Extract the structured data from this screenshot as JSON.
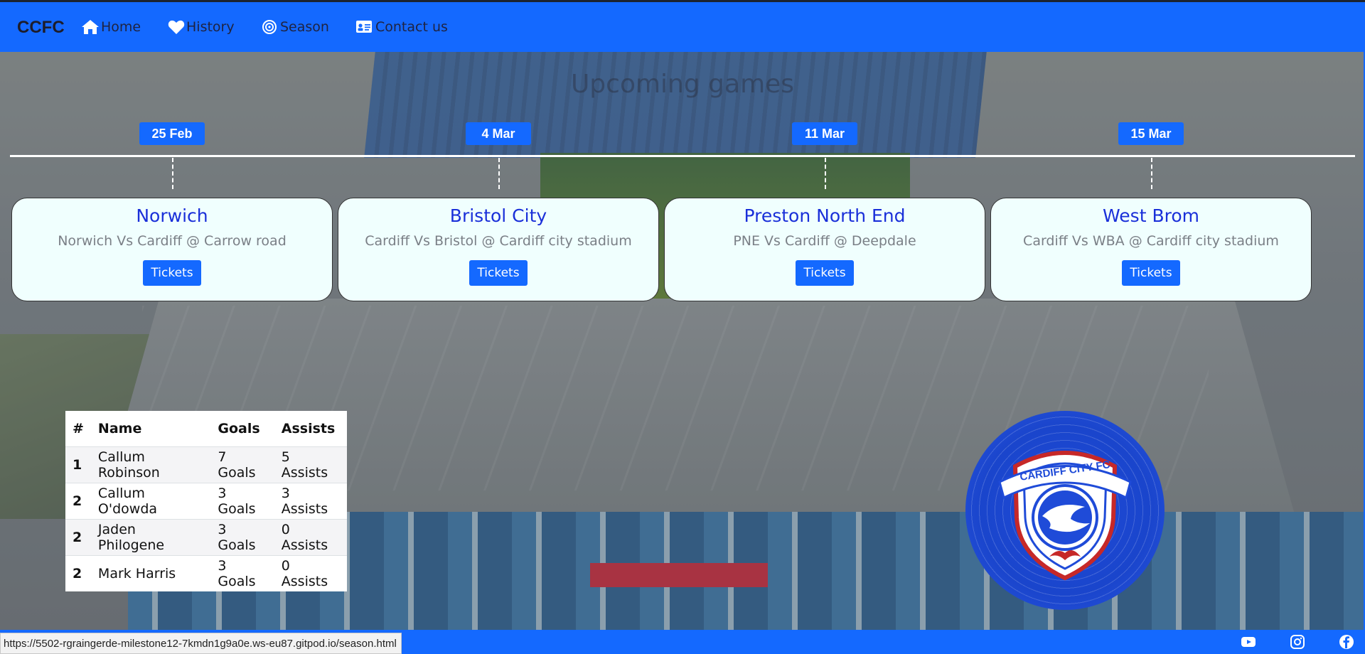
{
  "navbar": {
    "brand": "CCFC",
    "items": [
      {
        "label": "Home",
        "icon": "home-icon"
      },
      {
        "label": "History",
        "icon": "heart-icon"
      },
      {
        "label": "Season",
        "icon": "target-icon"
      },
      {
        "label": "Contact us",
        "icon": "contact-card-icon"
      }
    ]
  },
  "section_title": "Upcoming games",
  "fixtures": [
    {
      "date": "25 Feb",
      "title": "Norwich",
      "desc": "Norwich Vs Cardiff @ Carrow road",
      "button": "Tickets"
    },
    {
      "date": "4 Mar",
      "title": "Bristol City",
      "desc": "Cardiff Vs Bristol @ Cardiff city stadium",
      "button": "Tickets"
    },
    {
      "date": "11 Mar",
      "title": "Preston North End",
      "desc": "PNE Vs Cardiff @ Deepdale",
      "button": "Tickets"
    },
    {
      "date": "15 Mar",
      "title": "West Brom",
      "desc": "Cardiff Vs WBA @ Cardiff city stadium",
      "button": "Tickets"
    }
  ],
  "scorers": {
    "headers": [
      "#",
      "Name",
      "Goals",
      "Assists"
    ],
    "rows": [
      [
        "1",
        "Callum Robinson",
        "7 Goals",
        "5 Assists"
      ],
      [
        "2",
        "Callum O'dowda",
        "3 Goals",
        "3 Assists"
      ],
      [
        "2",
        "Jaden Philogene",
        "3 Goals",
        "0 Assists"
      ],
      [
        "2",
        "Mark Harris",
        "3 Goals",
        "0 Assists"
      ]
    ]
  },
  "crest": {
    "text": "CARDIFF CITY FC"
  },
  "status_url": "https://5502-rgraingerde-milestone12-7kmdn1g9a0e.ws-eu87.gitpod.io/season.html",
  "footer": {
    "icons": [
      "youtube-icon",
      "instagram-icon",
      "facebook-icon"
    ]
  },
  "colors": {
    "primary": "#1469ff",
    "card_bg": "#f0fffe",
    "card_title": "#1a2fd9",
    "crest_blue": "#1f4bd8"
  }
}
